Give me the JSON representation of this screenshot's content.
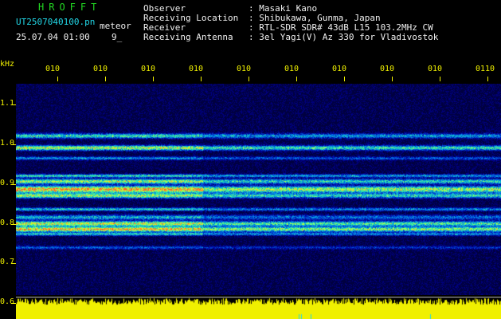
{
  "header": {
    "brand": "HROFFT",
    "filename": "UT2507040100.pn",
    "tag": "meteor",
    "datetime": "25.07.04 01:00",
    "count": "9_"
  },
  "info": {
    "labels": [
      "Observer",
      "Receiving Location",
      "Receiver",
      "Receiving Antenna"
    ],
    "values": [
      ": Masaki Kano",
      ": Shibukawa, Gunma, Japan",
      ": RTL-SDR SDR# 43dB L15 103.2MHz CW",
      ": 3el Yagi(V) Az 330 for Vladivostok"
    ]
  },
  "axis": {
    "yunit": "kHz",
    "yticks": [
      "1.1",
      "1.0",
      "0.9",
      "0.8",
      "0.7",
      "0.6"
    ],
    "xticks": [
      "010",
      "010",
      "010",
      "010",
      "010",
      "010",
      "010",
      "010",
      "010",
      "0110"
    ]
  },
  "colors": {
    "background": "#000000",
    "brand": "#22d822",
    "filename": "#22d8e8",
    "info_text": "#f0f0f0",
    "axis": "#f0f000",
    "spectrogram_base": "#000080"
  }
}
